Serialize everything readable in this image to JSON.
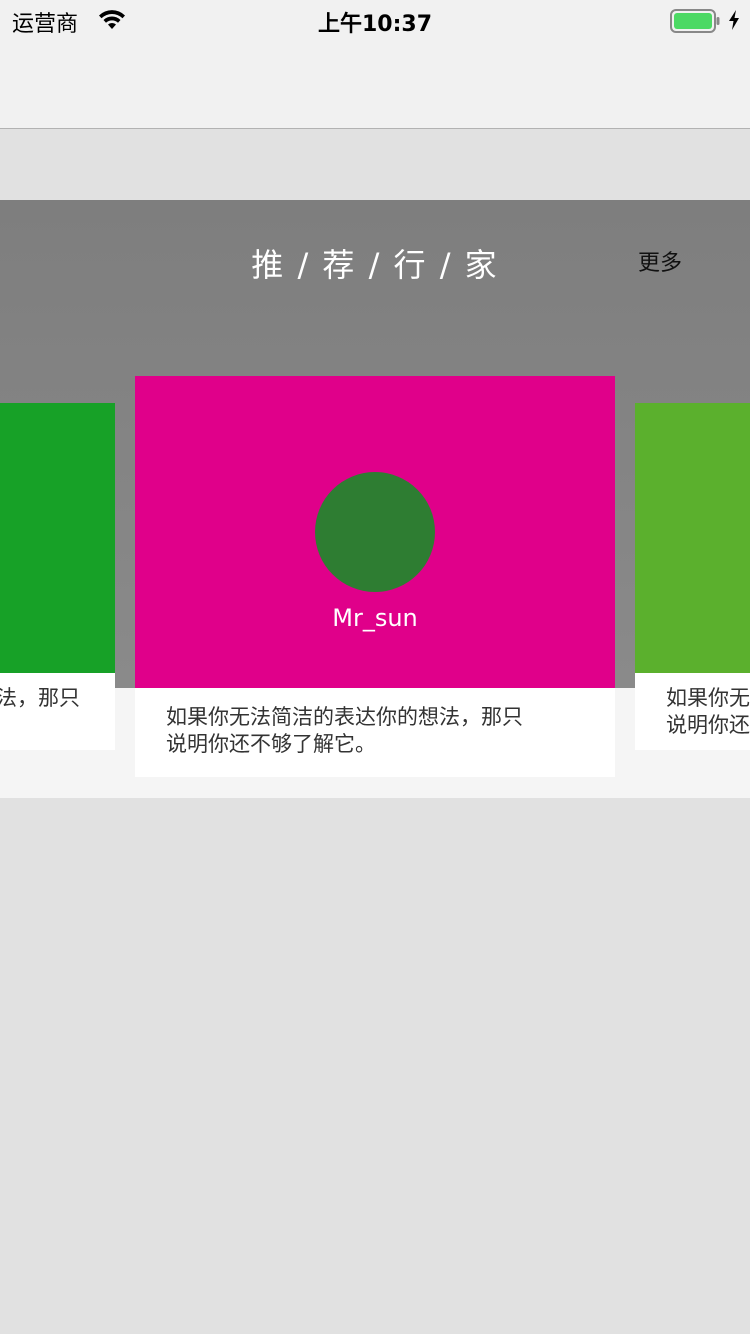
{
  "status_bar": {
    "carrier": "运营商",
    "time": "上午10:37",
    "battery_color": "#4cd964"
  },
  "section": {
    "title": "推 / 荐 / 行 / 家",
    "more_label": "更多"
  },
  "cards": {
    "left": {
      "color": "#17a127",
      "quote_visible": "法，那只"
    },
    "center": {
      "color": "#e0008a",
      "avatar_color": "#2e7d32",
      "name": "Mr_sun",
      "quote_line1": "如果你无法简洁的表达你的想法，那只",
      "quote_line2": "说明你还不够了解它。"
    },
    "right": {
      "color": "#5bb02d",
      "quote_line1": "如果你无",
      "quote_line2": "说明你还"
    }
  },
  "icons": {
    "wifi": "wifi-icon",
    "battery": "battery-icon",
    "charging": "charging-bolt-icon"
  }
}
